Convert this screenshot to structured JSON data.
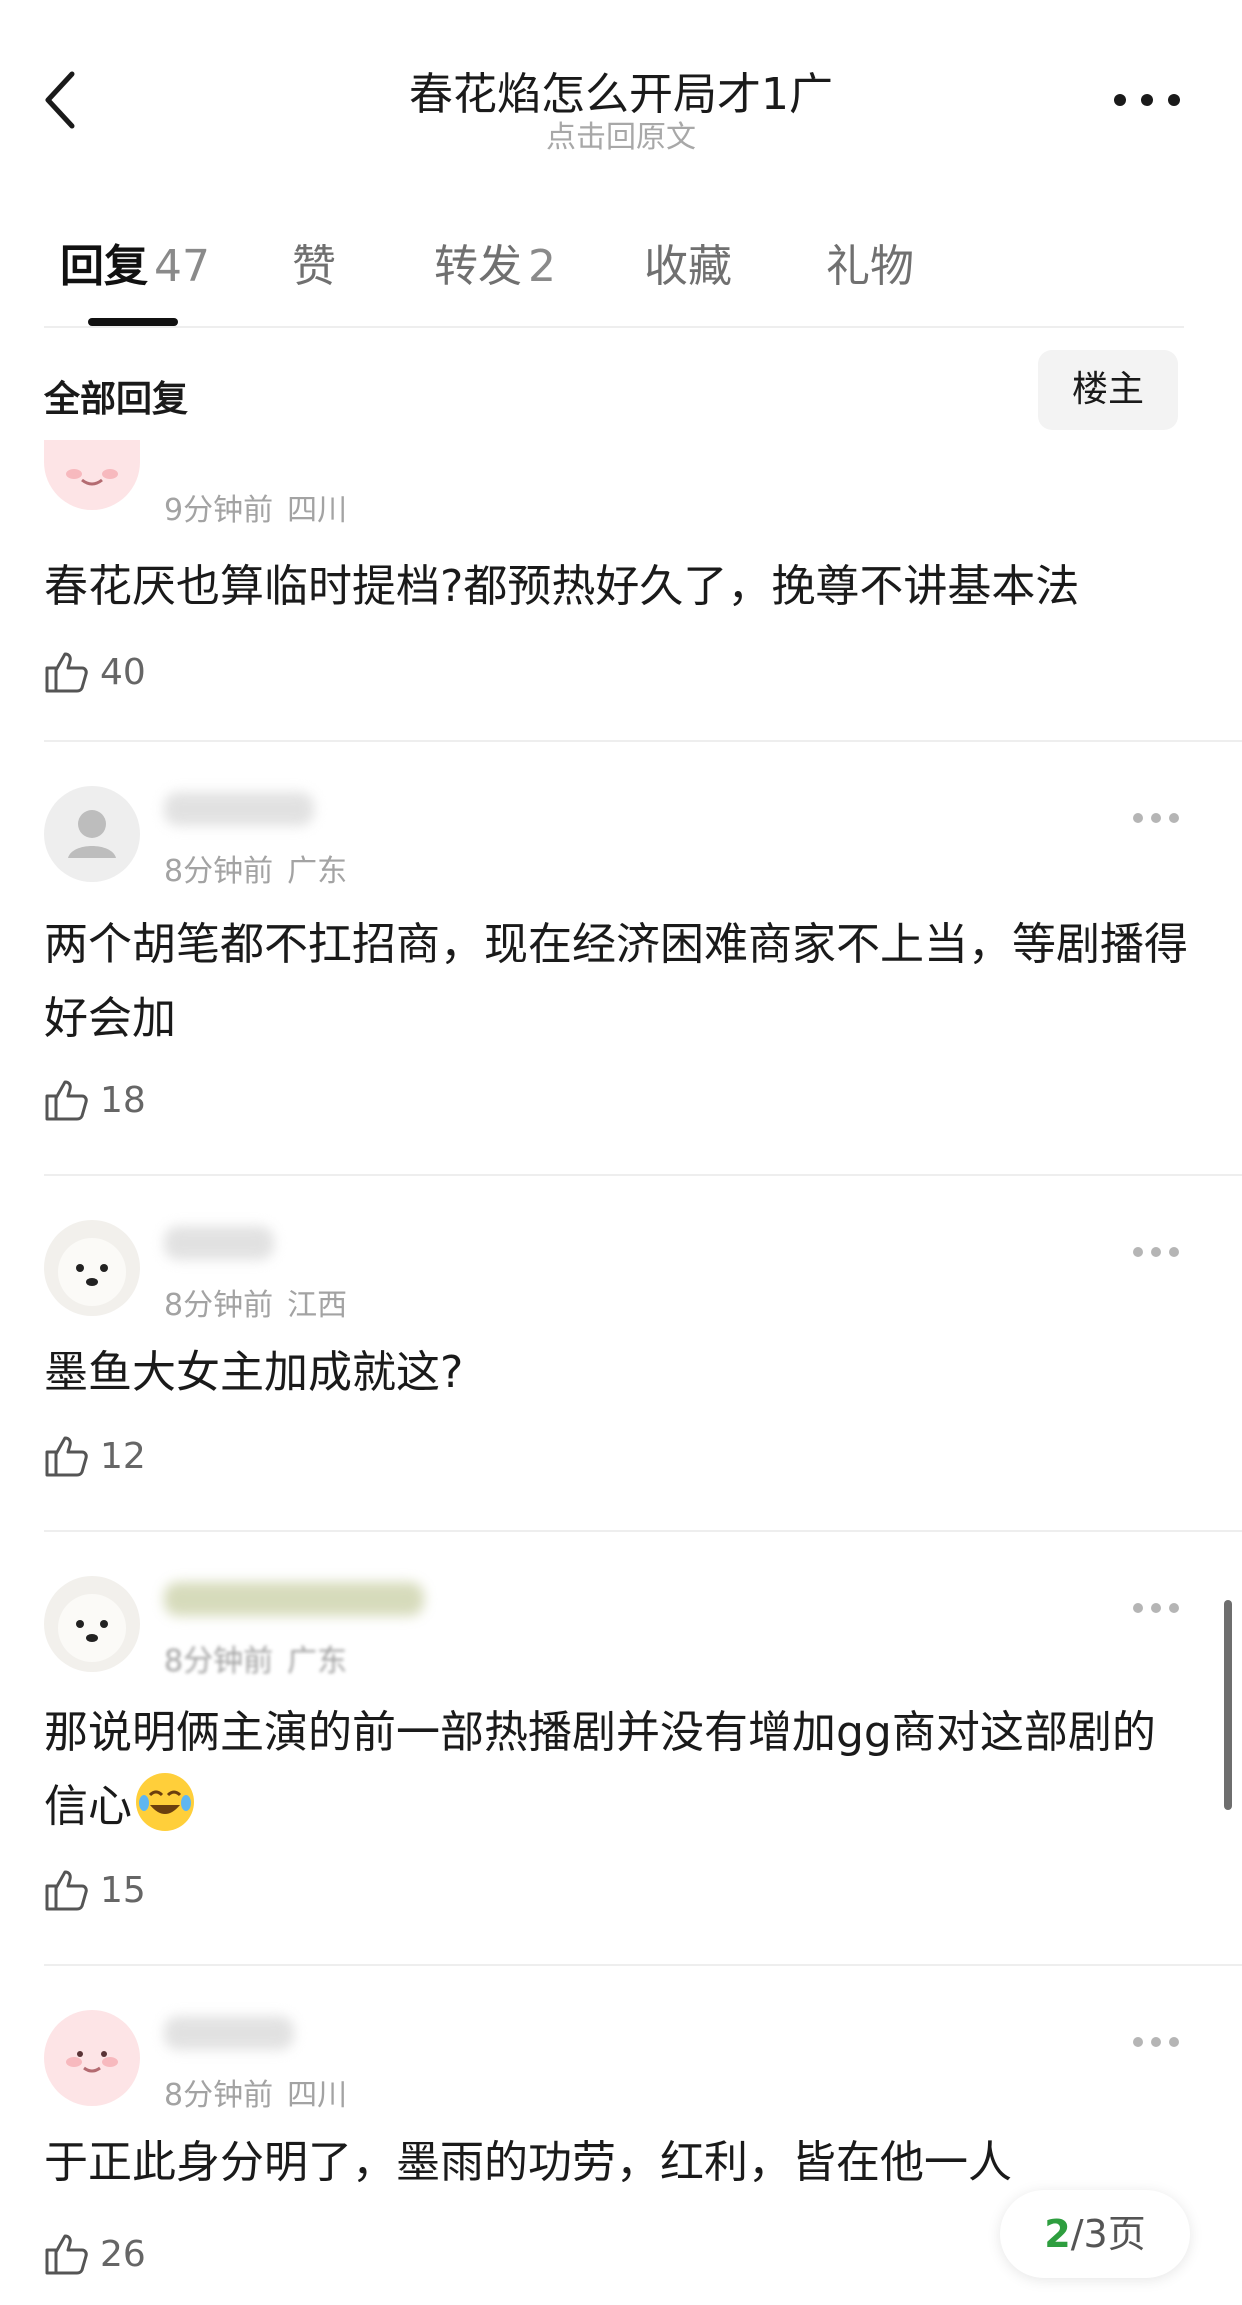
{
  "header": {
    "title": "春花焰怎么开局才1广",
    "subtitle": "点击回原文"
  },
  "tabs": [
    {
      "label": "回复",
      "count": "47"
    },
    {
      "label": "赞",
      "count": ""
    },
    {
      "label": "转发",
      "count": "2"
    },
    {
      "label": "收藏",
      "count": ""
    },
    {
      "label": "礼物",
      "count": ""
    }
  ],
  "filter": {
    "label": "全部回复",
    "op_button": "楼主"
  },
  "comments": [
    {
      "time": "9分钟前",
      "location": "四川",
      "text": "春花厌也算临时提档?都预热好久了，挽尊不讲基本法",
      "likes": "40"
    },
    {
      "time": "8分钟前",
      "location": "广东",
      "text": "两个胡笔都不扛招商，现在经济困难商家不上当，等剧播得好会加",
      "likes": "18"
    },
    {
      "time": "8分钟前",
      "location": "江西",
      "text": "墨鱼大女主加成就这?",
      "likes": "12"
    },
    {
      "time": "8分钟前",
      "location": "广东",
      "text": "那说明俩主演的前一部热播剧并没有增加gg商对这部剧的信心",
      "likes": "15"
    },
    {
      "time": "8分钟前",
      "location": "四川",
      "text": "于正此身分明了，墨雨的功劳，红利，皆在他一人",
      "likes": "26"
    }
  ],
  "pager": {
    "current": "2",
    "total": "/3页"
  },
  "colors": {
    "accent": "#111111",
    "pager_current": "#2e9e3f",
    "meta": "#a3a3a3"
  }
}
